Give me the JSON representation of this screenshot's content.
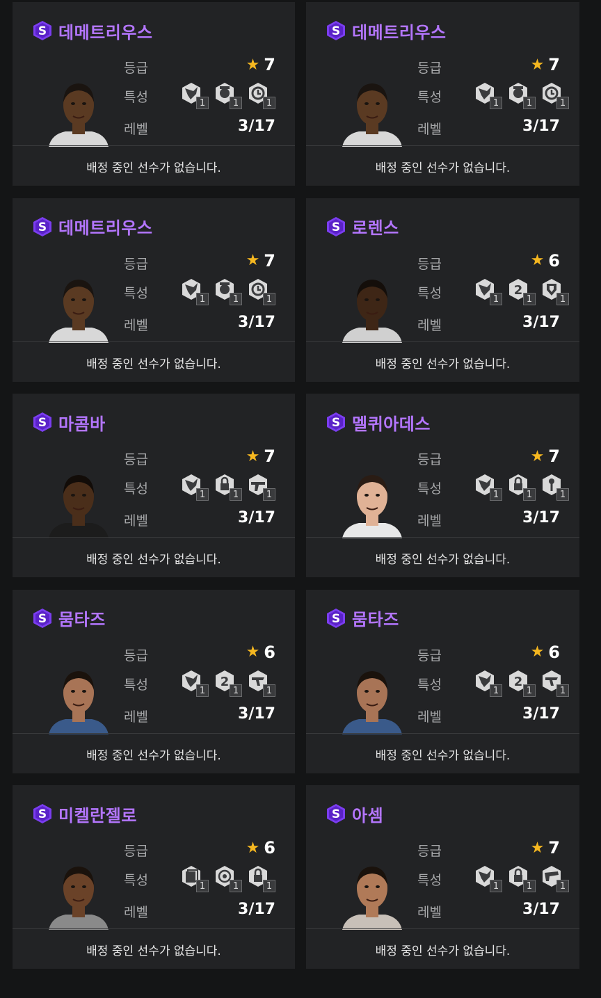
{
  "labels": {
    "grade": "등급",
    "trait": "특성",
    "level": "레벨",
    "badge": "S",
    "no_assignment": "배정 중인 선수가 없습니다."
  },
  "colors": {
    "name": "#b476ff",
    "badge": "#7b3df0",
    "star": "#f5b720",
    "card_bg": "#222325",
    "page_bg": "#141516"
  },
  "cards": [
    {
      "name": "데메트리우스",
      "grade": "7",
      "level": "3/17",
      "traits": [
        "shot-trait-icon",
        "rank-trait-icon",
        "dribble-trait-icon"
      ],
      "trait_levels": [
        "1",
        "1",
        "1"
      ]
    },
    {
      "name": "데메트리우스",
      "grade": "7",
      "level": "3/17",
      "traits": [
        "shot-trait-icon",
        "rank-trait-icon",
        "dribble-trait-icon"
      ],
      "trait_levels": [
        "1",
        "1",
        "1"
      ]
    },
    {
      "name": "데메트리우스",
      "grade": "7",
      "level": "3/17",
      "traits": [
        "shot-trait-icon",
        "rank-trait-icon",
        "dribble-trait-icon"
      ],
      "trait_levels": [
        "1",
        "1",
        "1"
      ]
    },
    {
      "name": "로렌스",
      "grade": "6",
      "level": "3/17",
      "traits": [
        "shot-trait-icon",
        "number-trait-icon",
        "shield-trait-icon"
      ],
      "trait_levels": [
        "1",
        "1",
        "1"
      ]
    },
    {
      "name": "마콤바",
      "grade": "7",
      "level": "3/17",
      "traits": [
        "shot-trait-icon",
        "lock-trait-icon",
        "kick-trait-icon"
      ],
      "trait_levels": [
        "1",
        "1",
        "1"
      ]
    },
    {
      "name": "멜퀴아데스",
      "grade": "7",
      "level": "3/17",
      "traits": [
        "shot-trait-icon",
        "lock-trait-icon",
        "key-trait-icon"
      ],
      "trait_levels": [
        "1",
        "1",
        "1"
      ]
    },
    {
      "name": "뭄타즈",
      "grade": "6",
      "level": "3/17",
      "traits": [
        "shot-trait-icon",
        "number-trait-icon",
        "run-trait-icon"
      ],
      "trait_levels": [
        "1",
        "1",
        "1"
      ]
    },
    {
      "name": "뭄타즈",
      "grade": "6",
      "level": "3/17",
      "traits": [
        "shot-trait-icon",
        "number-trait-icon",
        "run-trait-icon"
      ],
      "trait_levels": [
        "1",
        "1",
        "1"
      ]
    },
    {
      "name": "미켈란젤로",
      "grade": "6",
      "level": "3/17",
      "traits": [
        "card-trait-icon",
        "target-trait-icon",
        "lock-trait-icon"
      ],
      "trait_levels": [
        "1",
        "1",
        "1"
      ]
    },
    {
      "name": "아셈",
      "grade": "7",
      "level": "3/17",
      "traits": [
        "shot-trait-icon",
        "lock-trait-icon",
        "tackle-trait-icon"
      ],
      "trait_levels": [
        "1",
        "1",
        "1"
      ]
    }
  ],
  "portraits": [
    {
      "skin": "#5a3a22",
      "hair": "#1a1410",
      "shirt": "#d8d8d8"
    },
    {
      "skin": "#5a3a22",
      "hair": "#1a1410",
      "shirt": "#d8d8d8"
    },
    {
      "skin": "#5a3a22",
      "hair": "#1a1410",
      "shirt": "#d8d8d8"
    },
    {
      "skin": "#3e2616",
      "hair": "#140e0a",
      "shirt": "#d0d0d0"
    },
    {
      "skin": "#4a2e1a",
      "hair": "#120c08",
      "shirt": "#1c1c1c"
    },
    {
      "skin": "#e0b296",
      "hair": "#2a1c14",
      "shirt": "#e8e8e8"
    },
    {
      "skin": "#a87456",
      "hair": "#1a120c",
      "shirt": "#3a5a8a"
    },
    {
      "skin": "#a87456",
      "hair": "#1a120c",
      "shirt": "#3a5a8a"
    },
    {
      "skin": "#6a4228",
      "hair": "#1a120c",
      "shirt": "#8a8a8a"
    },
    {
      "skin": "#b07a58",
      "hair": "#1a120c",
      "shirt": "#c8c0b8"
    }
  ]
}
